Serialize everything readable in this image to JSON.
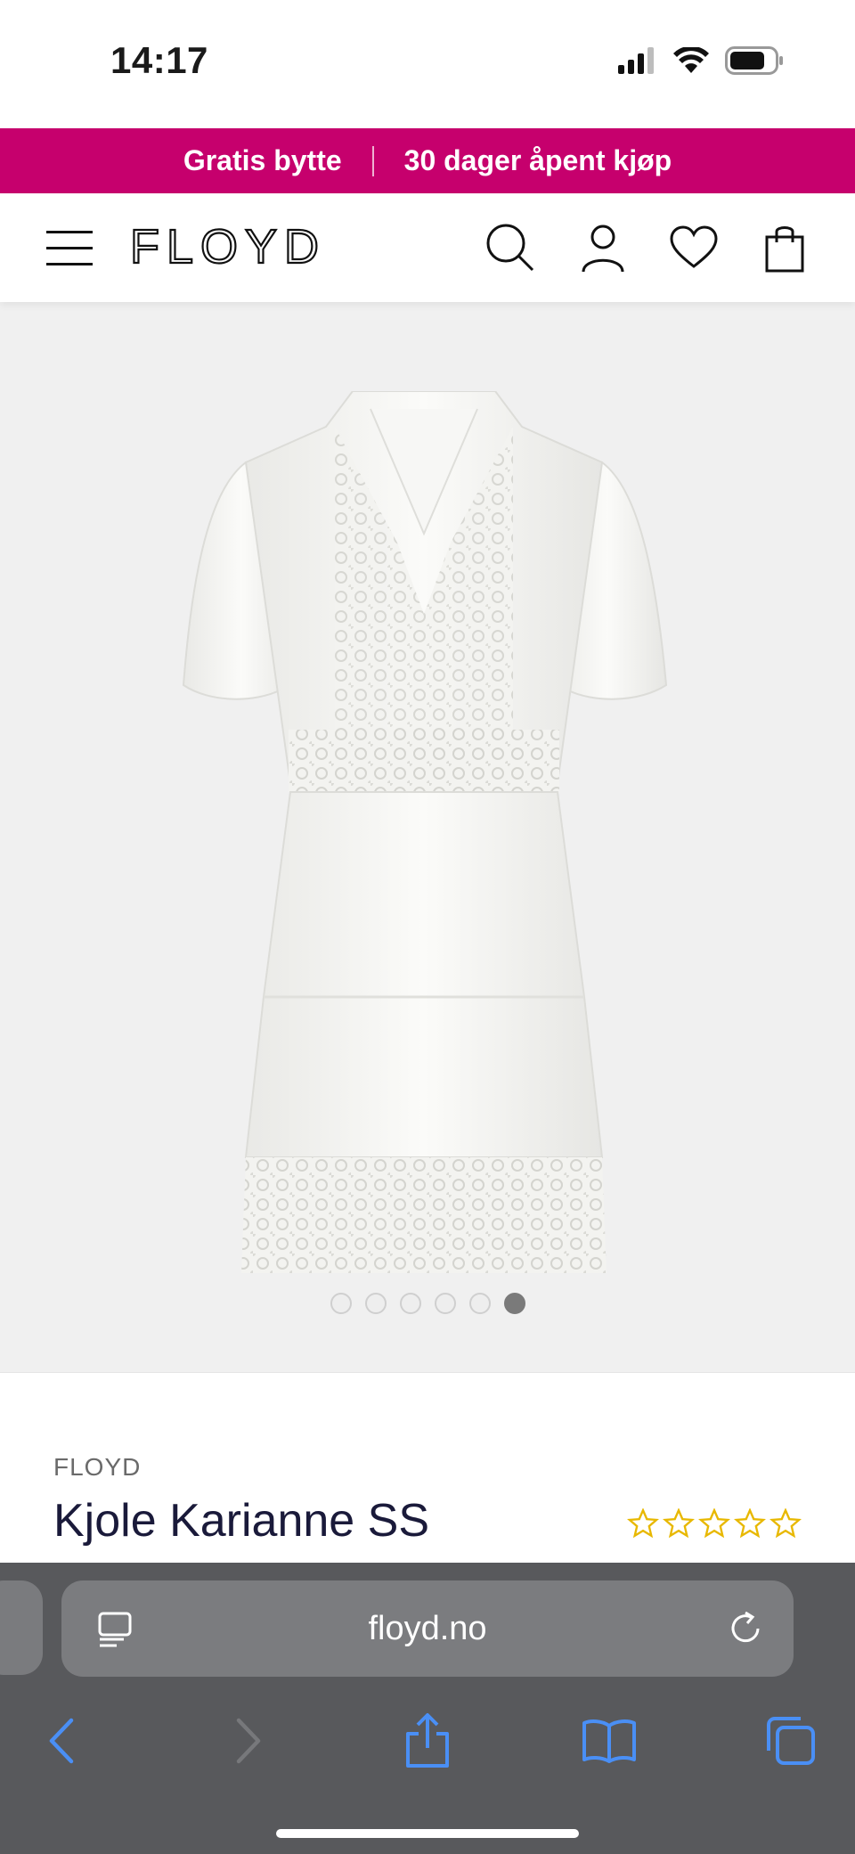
{
  "status_bar": {
    "time": "14:17",
    "icons": [
      "cellular-signal-icon",
      "wifi-icon",
      "battery-icon"
    ]
  },
  "promo": {
    "left_text": "Gratis bytte",
    "right_text": "30 dager åpent kjøp",
    "background": "#c6006d"
  },
  "header": {
    "logo_text": "FLOYD",
    "icons": [
      "menu-icon",
      "search-icon",
      "account-icon",
      "wishlist-heart-icon",
      "shopping-bag-icon"
    ]
  },
  "gallery": {
    "image_description": "white-lace-dress-image",
    "dot_count": 6,
    "active_dot": 6
  },
  "product": {
    "brand": "FLOYD",
    "title": "Kjole Karianne SS",
    "rating_stars": 5,
    "rating_value": 0
  },
  "browser": {
    "url": "floyd.no",
    "icons": [
      "reader-icon",
      "reload-icon",
      "back-icon",
      "forward-icon",
      "share-icon",
      "bookmarks-icon",
      "tabs-icon"
    ],
    "accent": "#4a8ff5"
  }
}
